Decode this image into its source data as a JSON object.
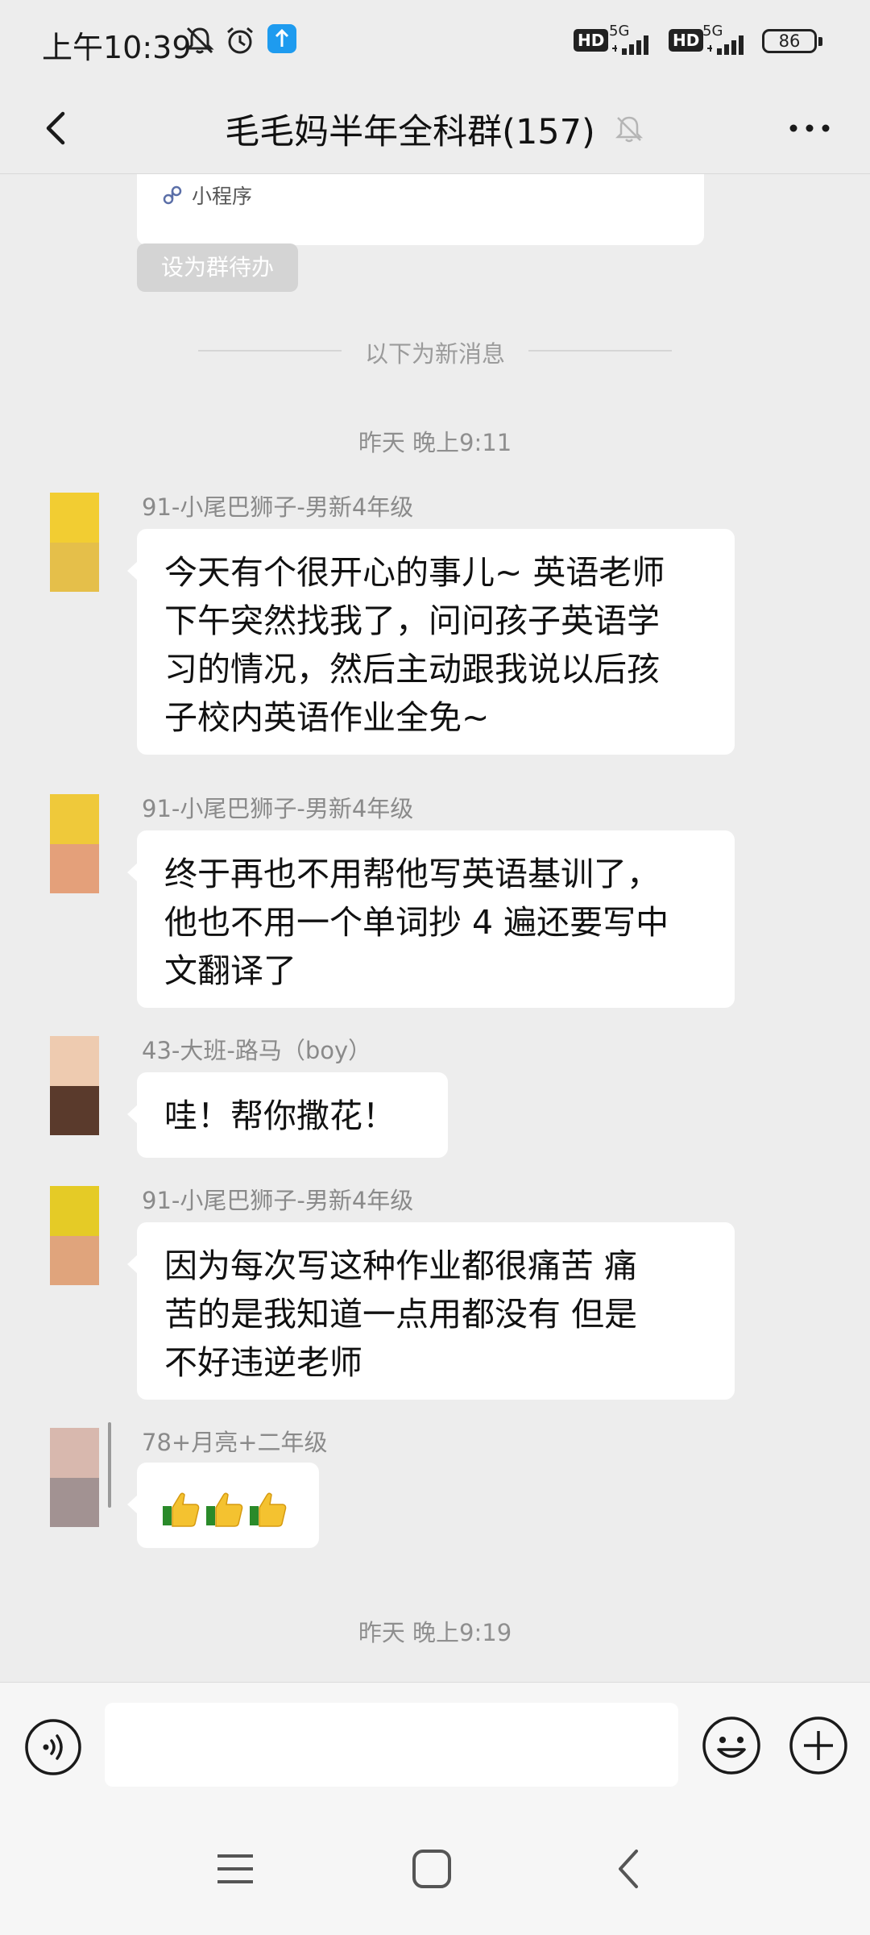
{
  "status_bar": {
    "time": "上午10:39",
    "network1_label": "HD",
    "network1_gen": "5G",
    "network2_label": "HD",
    "network2_gen": "5G",
    "battery": "86"
  },
  "header": {
    "title": "毛毛妈半年全科群(157)"
  },
  "mini_program": {
    "label": "小程序"
  },
  "todo_button": "设为群待办",
  "new_messages_divider": "以下为新消息",
  "timestamps": [
    "昨天 晚上9:11",
    "昨天 晚上9:19"
  ],
  "messages": [
    {
      "sender": "91-小尾巴狮子-男新4年级",
      "avatar_colors": [
        "#f2cd32",
        "#e5bf4a"
      ],
      "lines": [
        "今天有个很开心的事儿~ 英语老师",
        "下午突然找我了，问问孩子英语学",
        "习的情况，然后主动跟我说以后孩",
        "子校内英语作业全免~"
      ]
    },
    {
      "sender": "91-小尾巴狮子-男新4年级",
      "avatar_colors": [
        "#efc93a",
        "#e4a07a"
      ],
      "lines": [
        "终于再也不用帮他写英语基训了，",
        "他也不用一个单词抄 4 遍还要写中",
        "文翻译了"
      ]
    },
    {
      "sender": "43-大班-路马（boy）",
      "avatar_colors": [
        "#eecbb0",
        "#5a3a2c"
      ],
      "lines": [
        "哇！帮你撒花！"
      ]
    },
    {
      "sender": "91-小尾巴狮子-男新4年级",
      "avatar_colors": [
        "#e5cb26",
        "#e0a47c"
      ],
      "lines": [
        "因为每次写这种作业都很痛苦 痛",
        "苦的是我知道一点用都没有 但是",
        "不好违逆老师"
      ]
    },
    {
      "sender": "78+月亮+二年级",
      "avatar_colors": [
        "#d8b8ae",
        "#a29292"
      ],
      "emoji": [
        "thumbs-up",
        "thumbs-up",
        "thumbs-up"
      ]
    }
  ],
  "input": {
    "value": "",
    "placeholder": ""
  }
}
